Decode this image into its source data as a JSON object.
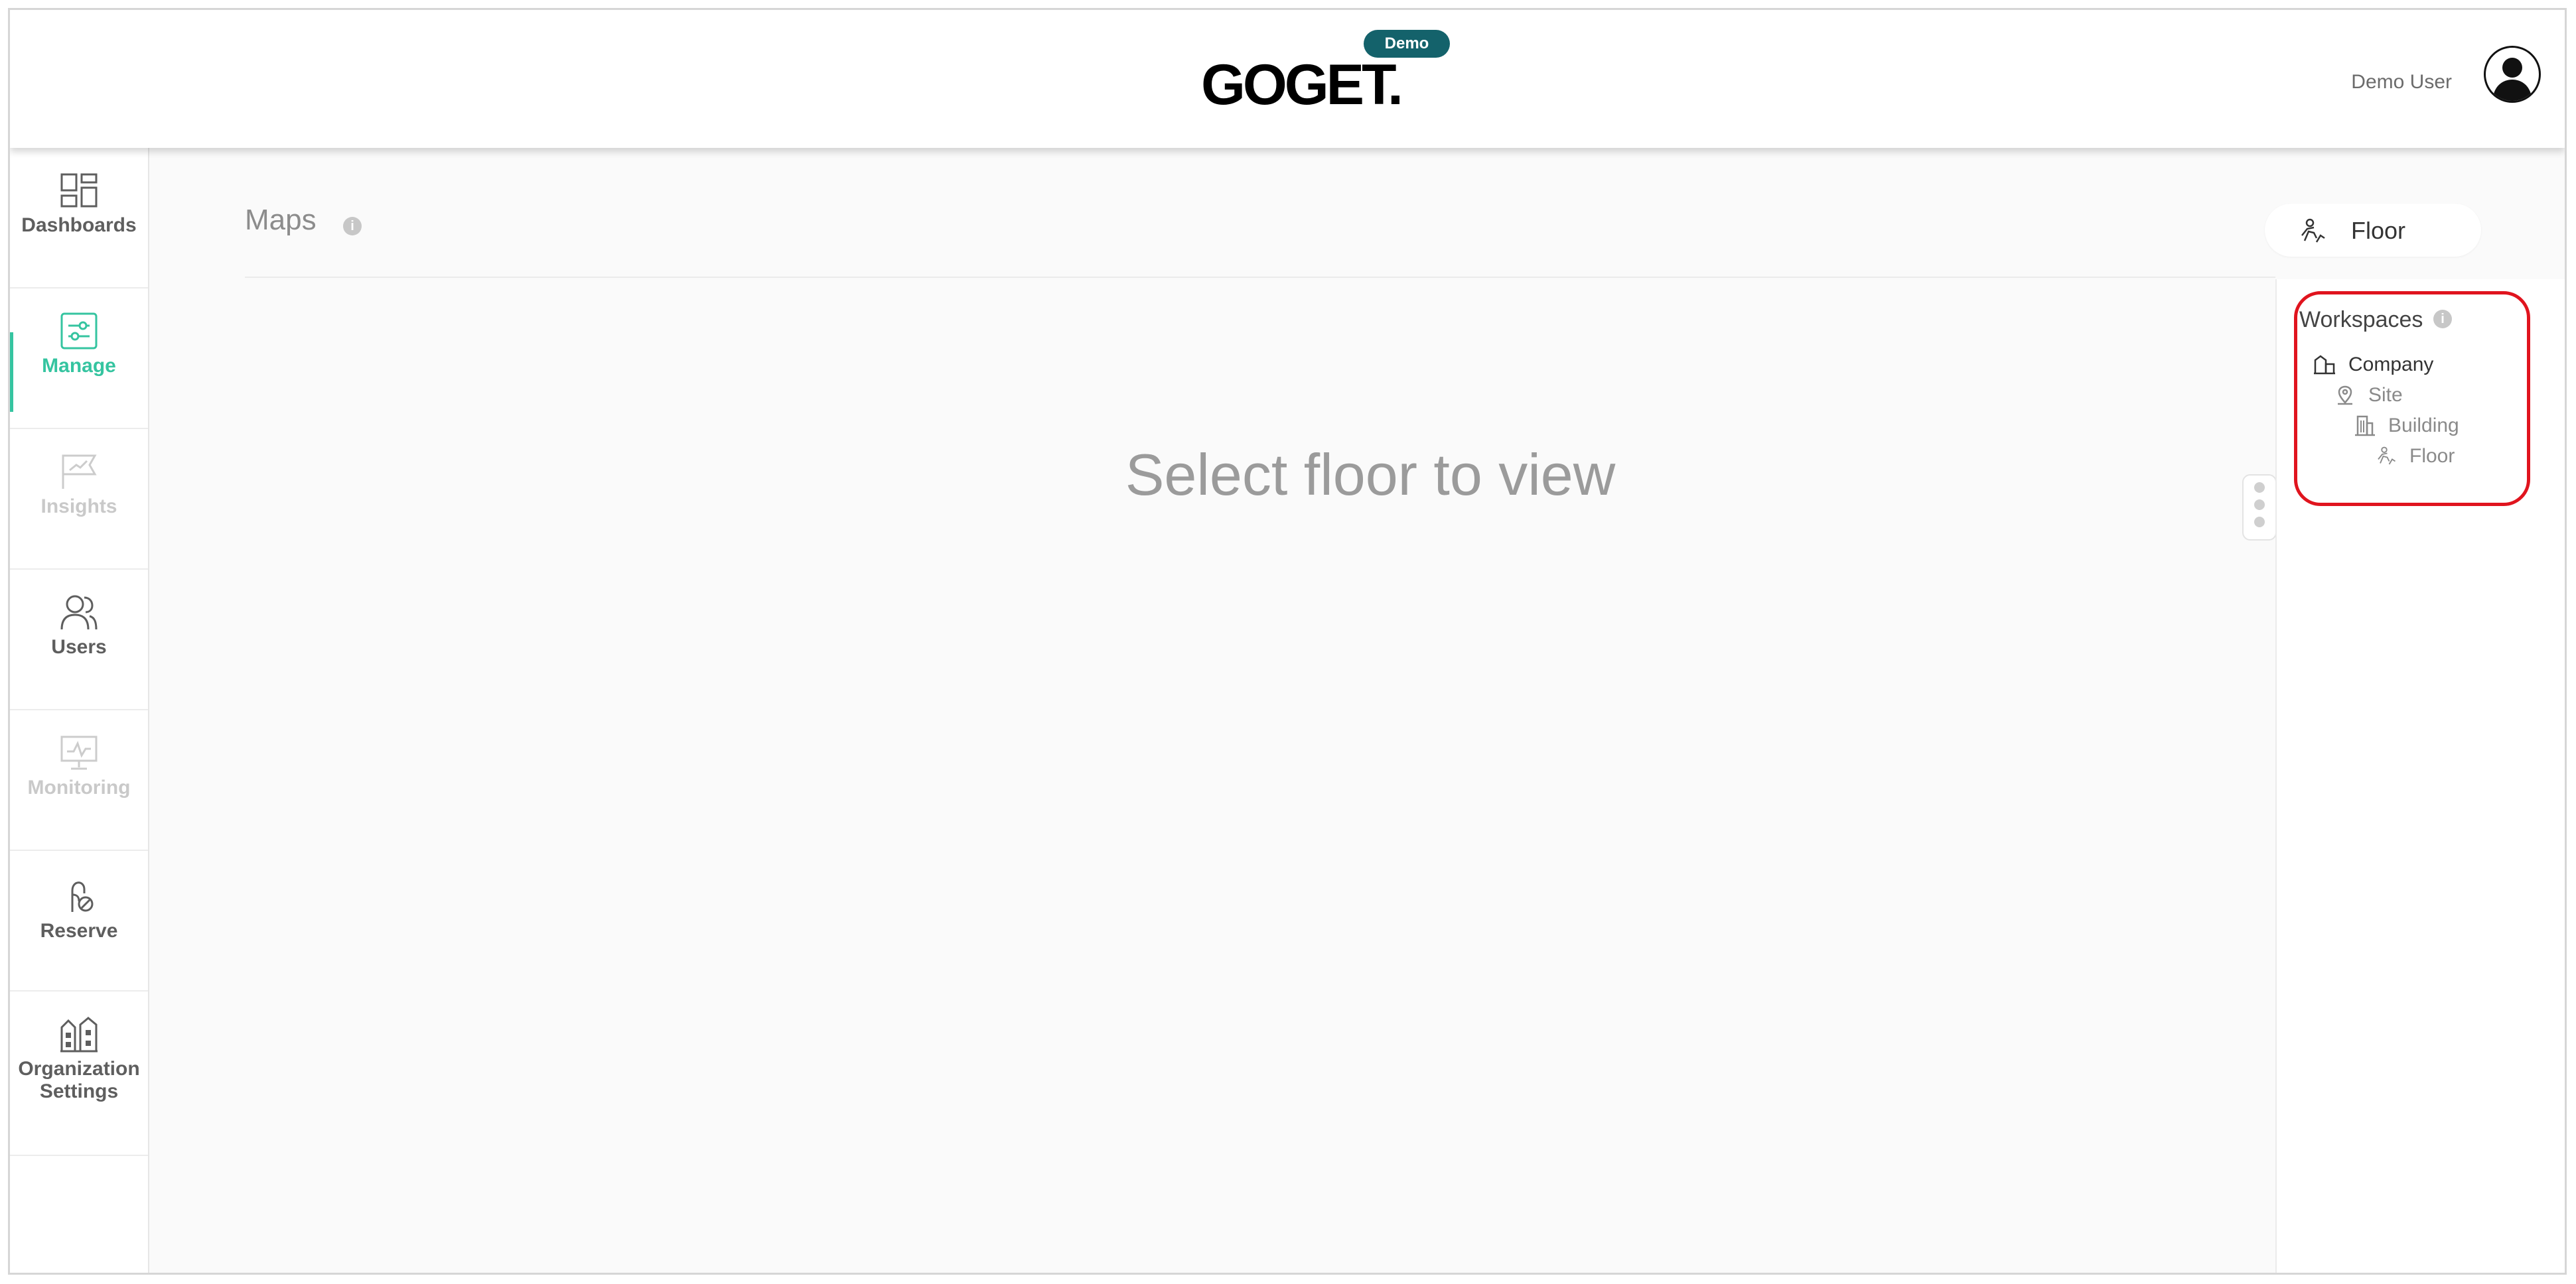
{
  "header": {
    "logo": "GOGET.",
    "badge": "Demo",
    "user_name": "Demo User"
  },
  "sidebar": {
    "items": [
      {
        "label": "Dashboards",
        "icon": "dashboards-icon",
        "state": "default"
      },
      {
        "label": "Manage",
        "icon": "manage-sliders-icon",
        "state": "active"
      },
      {
        "label": "Insights",
        "icon": "insights-flag-icon",
        "state": "disabled"
      },
      {
        "label": "Users",
        "icon": "users-icon",
        "state": "default"
      },
      {
        "label": "Monitoring",
        "icon": "monitoring-icon",
        "state": "disabled"
      },
      {
        "label": "Reserve",
        "icon": "reserve-icon",
        "state": "default"
      },
      {
        "label": "Organization Settings",
        "icon": "organization-buildings-icon",
        "state": "default"
      }
    ]
  },
  "main": {
    "title": "Maps",
    "info_glyph": "i",
    "empty_message": "Select floor to view",
    "floor_selector": "Floor"
  },
  "workspaces": {
    "title": "Workspaces",
    "info_glyph": "i",
    "tree": [
      {
        "label": "Company",
        "icon": "company-icon"
      },
      {
        "label": "Site",
        "icon": "site-pin-icon"
      },
      {
        "label": "Building",
        "icon": "building-icon"
      },
      {
        "label": "Floor",
        "icon": "floor-icon"
      }
    ]
  },
  "colors": {
    "accent": "#35c4a0",
    "badge": "#14626b",
    "highlight": "#e0141e"
  }
}
